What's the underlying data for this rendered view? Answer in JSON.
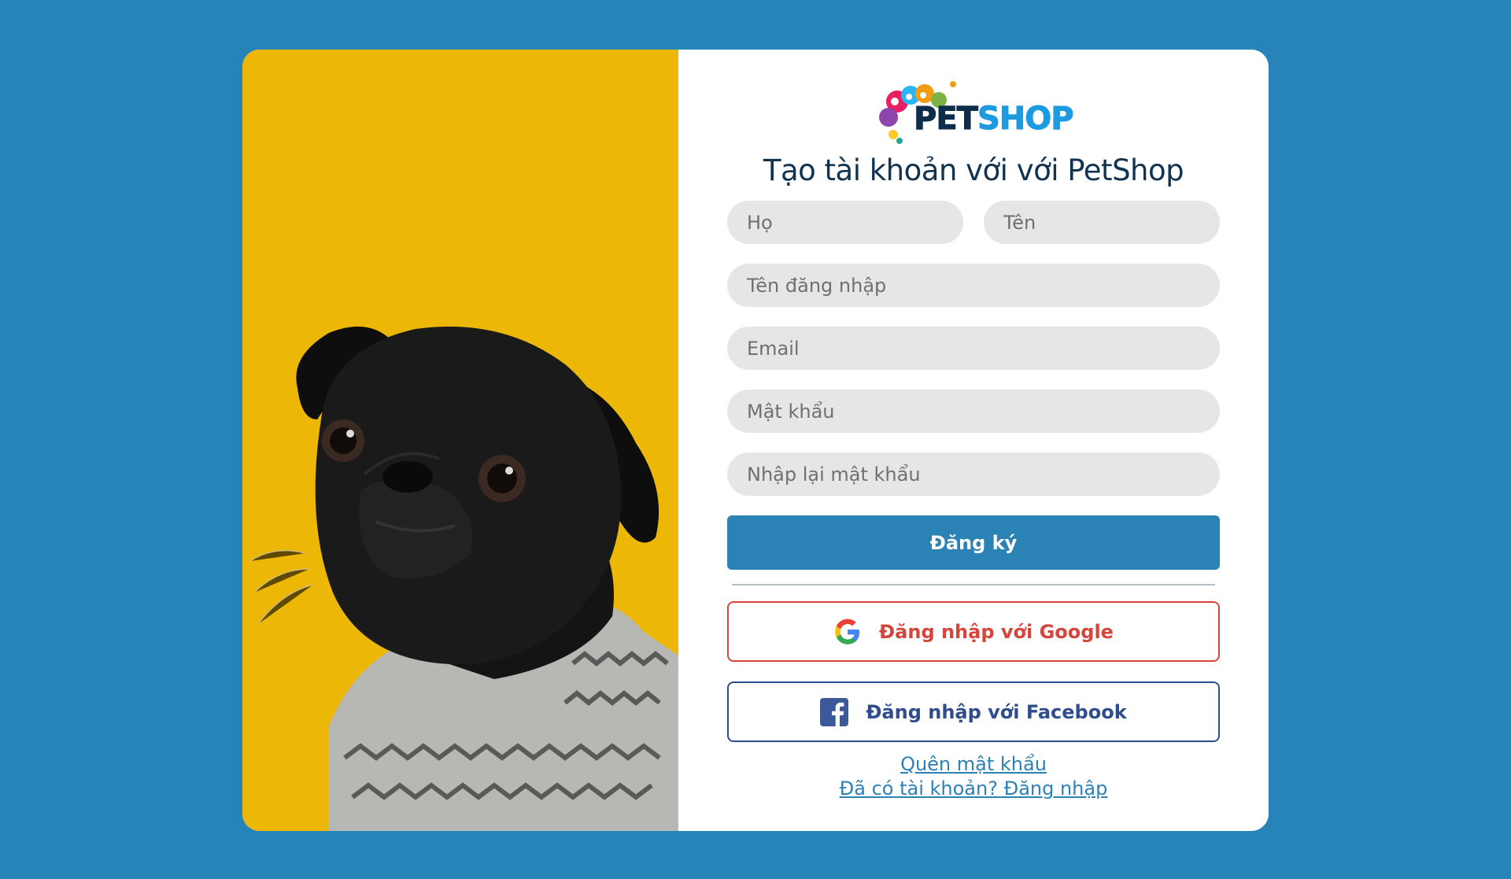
{
  "logo": {
    "text_part1": "PET",
    "text_part2": "SHOP"
  },
  "title": "Tạo tài khoản với với PetShop",
  "fields": {
    "last_name_placeholder": "Họ",
    "first_name_placeholder": "Tên",
    "username_placeholder": "Tên đăng nhập",
    "email_placeholder": "Email",
    "password_placeholder": "Mật khẩu",
    "confirm_password_placeholder": "Nhập lại mật khẩu"
  },
  "buttons": {
    "register": "Đăng ký",
    "google": "Đăng nhập với Google",
    "facebook": "Đăng nhập với Facebook"
  },
  "links": {
    "forgot_password": "Quên mật khẩu",
    "have_account": "Đã có tài khoản? Đăng nhập"
  },
  "icons": {
    "google": "google-icon",
    "facebook": "facebook-icon"
  },
  "colors": {
    "background": "#2784b8",
    "left_panel": "#ecb706",
    "register_button": "#2b82b5",
    "google_accent": "#d6453b",
    "facebook_accent": "#2f4c8e",
    "title": "#0f3350"
  }
}
